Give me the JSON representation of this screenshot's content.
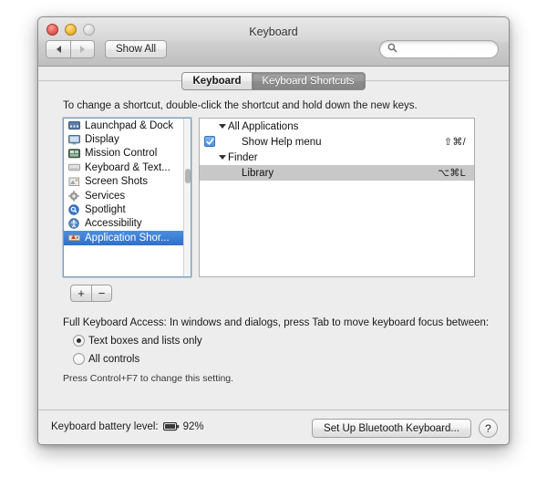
{
  "window": {
    "title": "Keyboard",
    "traffic_lights": [
      "close",
      "minimize",
      "zoom"
    ]
  },
  "toolbar": {
    "back_label": "◀",
    "forward_label": "▶",
    "show_all_label": "Show All",
    "search_placeholder": "",
    "search_value": "",
    "search_icon": "search-icon"
  },
  "tabs": [
    {
      "label": "Keyboard",
      "active": false
    },
    {
      "label": "Keyboard Shortcuts",
      "active": true
    }
  ],
  "instruction": "To change a shortcut, double-click the shortcut and hold down the new keys.",
  "sidebar": {
    "items": [
      {
        "label": "Launchpad & Dock",
        "icon": "launchpad-dock-icon",
        "selected": false
      },
      {
        "label": "Display",
        "icon": "display-icon",
        "selected": false
      },
      {
        "label": "Mission Control",
        "icon": "mission-control-icon",
        "selected": false
      },
      {
        "label": "Keyboard & Text...",
        "icon": "keyboard-text-icon",
        "selected": false
      },
      {
        "label": "Screen Shots",
        "icon": "screen-shots-icon",
        "selected": false
      },
      {
        "label": "Services",
        "icon": "services-icon",
        "selected": false
      },
      {
        "label": "Spotlight",
        "icon": "spotlight-icon",
        "selected": false
      },
      {
        "label": "Accessibility",
        "icon": "accessibility-icon",
        "selected": false
      },
      {
        "label": "Application Shor...",
        "icon": "application-shortcuts-icon",
        "selected": true
      }
    ]
  },
  "shortcuts": {
    "rows": [
      {
        "type": "group",
        "label": "All Applications",
        "expanded": true,
        "keys": ""
      },
      {
        "type": "item",
        "label": "Show Help menu",
        "checked": true,
        "keys": "⇧⌘/",
        "selected": false
      },
      {
        "type": "group",
        "label": "Finder",
        "expanded": true,
        "keys": ""
      },
      {
        "type": "item",
        "label": "Library",
        "checked": false,
        "keys": "⌥⌘L",
        "selected": true
      }
    ]
  },
  "list_controls": {
    "add_label": "+",
    "remove_label": "−"
  },
  "full_keyboard_access": {
    "title": "Full Keyboard Access: In windows and dialogs, press Tab to move keyboard focus between:",
    "options": [
      {
        "label": "Text boxes and lists only",
        "selected": true
      },
      {
        "label": "All controls",
        "selected": false
      }
    ],
    "hint": "Press Control+F7 to change this setting."
  },
  "bottom_bar": {
    "battery_label": "Keyboard battery level:",
    "battery_percent": "92%",
    "battery_icon": "battery-icon",
    "bluetooth_button_label": "Set Up Bluetooth Keyboard...",
    "help_button_label": "?"
  },
  "colors": {
    "selection_blue": "#2f6fcb",
    "row_selection_gray": "#c8c8c8",
    "checkbox_blue": "#4f92dd",
    "window_bg": "#ededed"
  }
}
